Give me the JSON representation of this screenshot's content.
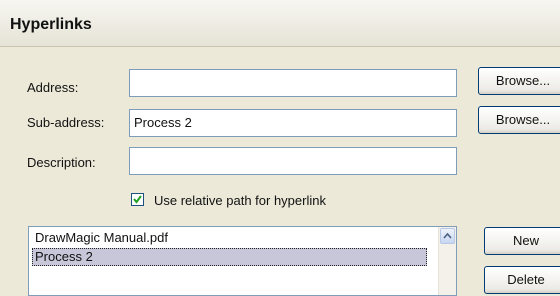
{
  "dialog": {
    "title": "Hyperlinks"
  },
  "form": {
    "address": {
      "label": "Address:",
      "value": "",
      "browse_label": "Browse..."
    },
    "sub_address": {
      "label": "Sub-address:",
      "value": "Process 2",
      "browse_label": "Browse..."
    },
    "description": {
      "label": "Description:",
      "value": ""
    },
    "relative_path": {
      "label": "Use relative path for hyperlink",
      "checked": true
    }
  },
  "links_list": {
    "items": [
      {
        "label": "DrawMagic Manual.pdf",
        "selected": false
      },
      {
        "label": "Process 2",
        "selected": true
      }
    ]
  },
  "buttons": {
    "new_label": "New",
    "delete_label": "Delete"
  }
}
